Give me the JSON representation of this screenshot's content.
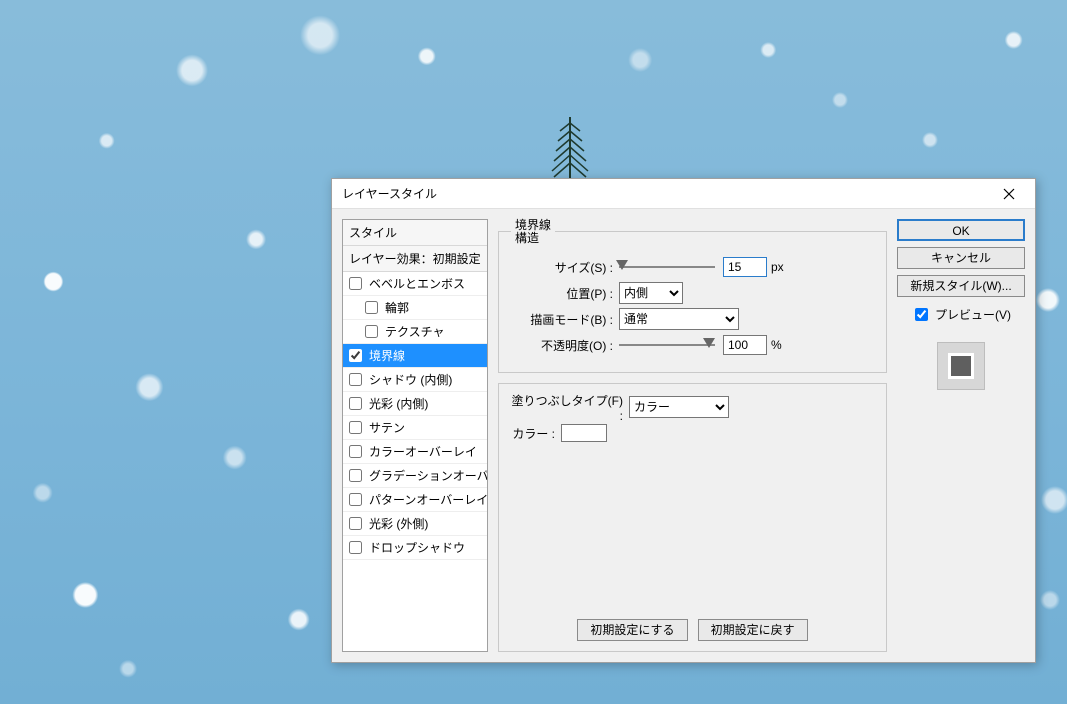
{
  "dialog": {
    "title": "レイヤースタイル"
  },
  "styles_list": {
    "header": "スタイル",
    "subheader": "レイヤー効果：初期設定",
    "items": [
      {
        "label": "ベベルとエンボス",
        "checked": false,
        "indent": false
      },
      {
        "label": "輪郭",
        "checked": false,
        "indent": true
      },
      {
        "label": "テクスチャ",
        "checked": false,
        "indent": true
      },
      {
        "label": "境界線",
        "checked": true,
        "indent": false,
        "selected": true
      },
      {
        "label": "シャドウ (内側)",
        "checked": false,
        "indent": false
      },
      {
        "label": "光彩 (内側)",
        "checked": false,
        "indent": false
      },
      {
        "label": "サテン",
        "checked": false,
        "indent": false
      },
      {
        "label": "カラーオーバーレイ",
        "checked": false,
        "indent": false
      },
      {
        "label": "グラデーションオーバーレイ",
        "checked": false,
        "indent": false
      },
      {
        "label": "パターンオーバーレイ",
        "checked": false,
        "indent": false
      },
      {
        "label": "光彩 (外側)",
        "checked": false,
        "indent": false
      },
      {
        "label": "ドロップシャドウ",
        "checked": false,
        "indent": false
      }
    ]
  },
  "stroke": {
    "group_label_line1": "境界線",
    "group_label_line2": "構造",
    "size_label": "サイズ(S) :",
    "size_value": "15",
    "size_unit": "px",
    "position_label": "位置(P) :",
    "position_value": "内側",
    "blend_label": "描画モード(B) :",
    "blend_value": "通常",
    "opacity_label": "不透明度(O) :",
    "opacity_value": "100",
    "opacity_unit": "%",
    "fill_type_label": "塗りつぶしタイプ(F) :",
    "fill_type_value": "カラー",
    "color_label": "カラー :"
  },
  "buttons": {
    "make_default": "初期設定にする",
    "reset_default": "初期設定に戻す",
    "ok": "OK",
    "cancel": "キャンセル",
    "new_style": "新規スタイル(W)...",
    "preview": "プレビュー(V)"
  }
}
